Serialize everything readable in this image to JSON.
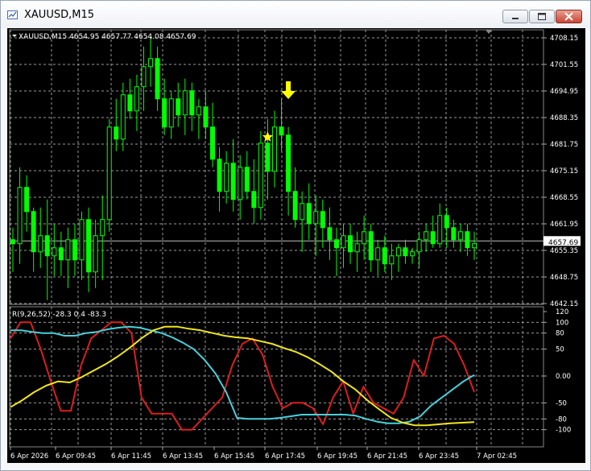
{
  "window": {
    "title": "XAUUSD,M15",
    "icon": "chart-window-icon"
  },
  "buttons": {
    "minimize_icon": "minimize-icon",
    "maximize_icon": "maximize-icon",
    "close_icon": "close-icon"
  },
  "colors": {
    "background": "#000000",
    "candle": "#00ff00",
    "price_line": "#c0c0c0",
    "red_line": "#dc1e1e",
    "cyan_line": "#46d2dc",
    "yellow_line": "#f0e61e",
    "marker": "#ffff00"
  },
  "main": {
    "info": "XAUUSD,M15  4654.95 4657.77 4654.08 4657.69",
    "current_price": "4657.69",
    "markers": [
      {
        "name": "down-arrow-icon"
      },
      {
        "name": "star-icon"
      }
    ]
  },
  "indicator": {
    "info": "R(9,26,52) -28.3 0.4 -83.3"
  },
  "x_labels": [
    "6 Apr 2026",
    "6 Apr 09:45",
    "6 Apr 11:45",
    "6 Apr 13:45",
    "6 Apr 15:45",
    "6 Apr 17:45",
    "6 Apr 19:45",
    "6 Apr 21:45",
    "6 Apr 23:45",
    "7 Apr 02:45"
  ],
  "chart_data": [
    {
      "type": "candlestick",
      "title": "XAUUSD,M15",
      "ylim": [
        4642.15,
        4708.15
      ],
      "y_ticks": [
        "4708.15",
        "4701.55",
        "4694.95",
        "4688.35",
        "4681.75",
        "4675.15",
        "4668.55",
        "4661.95",
        "4655.35",
        "4648.75",
        "4642.15"
      ],
      "last_price": 4657.69,
      "candles": [
        [
          4658,
          4661,
          4650,
          4657
        ],
        [
          4657,
          4676,
          4652,
          4671
        ],
        [
          4671,
          4674,
          4660,
          4665
        ],
        [
          4665,
          4666,
          4650,
          4655
        ],
        [
          4655,
          4666,
          4651,
          4659
        ],
        [
          4659,
          4668,
          4643,
          4654
        ],
        [
          4654,
          4662,
          4649,
          4656
        ],
        [
          4656,
          4660,
          4649,
          4653
        ],
        [
          4653,
          4661,
          4646,
          4658
        ],
        [
          4658,
          4662,
          4649,
          4653
        ],
        [
          4653,
          4665,
          4648,
          4663
        ],
        [
          4663,
          4666,
          4645,
          4650
        ],
        [
          4650,
          4663,
          4646,
          4659
        ],
        [
          4659,
          4669,
          4648,
          4663
        ],
        [
          4663,
          4688,
          4660,
          4686
        ],
        [
          4686,
          4693,
          4680,
          4683
        ],
        [
          4683,
          4697,
          4680,
          4694
        ],
        [
          4694,
          4698,
          4688,
          4690
        ],
        [
          4690,
          4699,
          4685,
          4696
        ],
        [
          4696,
          4706,
          4690,
          4701
        ],
        [
          4701,
          4708,
          4696,
          4703
        ],
        [
          4703,
          4706,
          4690,
          4693
        ],
        [
          4693,
          4698,
          4684,
          4686
        ],
        [
          4686,
          4695,
          4683,
          4693
        ],
        [
          4693,
          4697,
          4686,
          4689
        ],
        [
          4689,
          4698,
          4684,
          4695
        ],
        [
          4695,
          4697,
          4685,
          4689
        ],
        [
          4689,
          4693,
          4683,
          4691
        ],
        [
          4691,
          4695,
          4683,
          4686
        ],
        [
          4686,
          4692,
          4676,
          4678
        ],
        [
          4678,
          4681,
          4665,
          4670
        ],
        [
          4670,
          4680,
          4667,
          4677
        ],
        [
          4677,
          4683,
          4665,
          4668
        ],
        [
          4668,
          4679,
          4663,
          4676
        ],
        [
          4676,
          4680,
          4668,
          4670
        ],
        [
          4670,
          4678,
          4662,
          4666
        ],
        [
          4666,
          4685,
          4663,
          4682
        ],
        [
          4682,
          4688,
          4668,
          4675
        ],
        [
          4675,
          4690,
          4671,
          4686
        ],
        [
          4686,
          4693,
          4680,
          4684
        ],
        [
          4684,
          4686,
          4664,
          4670
        ],
        [
          4670,
          4676,
          4661,
          4663
        ],
        [
          4663,
          4670,
          4655,
          4667
        ],
        [
          4667,
          4672,
          4658,
          4662
        ],
        [
          4662,
          4669,
          4654,
          4665
        ],
        [
          4665,
          4668,
          4656,
          4661
        ],
        [
          4661,
          4666,
          4653,
          4658
        ],
        [
          4658,
          4661,
          4649,
          4656
        ],
        [
          4656,
          4662,
          4651,
          4659
        ],
        [
          4659,
          4662,
          4652,
          4655
        ],
        [
          4655,
          4660,
          4650,
          4657
        ],
        [
          4657,
          4664,
          4653,
          4660
        ],
        [
          4660,
          4662,
          4650,
          4653
        ],
        [
          4653,
          4658,
          4649,
          4656
        ],
        [
          4656,
          4659,
          4650,
          4652
        ],
        [
          4652,
          4657,
          4648,
          4654
        ],
        [
          4654,
          4657,
          4650,
          4656
        ],
        [
          4656,
          4658,
          4652,
          4654
        ],
        [
          4654,
          4656,
          4652,
          4655
        ],
        [
          4655,
          4660,
          4651,
          4658
        ],
        [
          4658,
          4662,
          4655,
          4660
        ],
        [
          4660,
          4664,
          4656,
          4657
        ],
        [
          4657,
          4667,
          4656,
          4664
        ],
        [
          4664,
          4666,
          4656,
          4661
        ],
        [
          4661,
          4663,
          4656,
          4658
        ],
        [
          4658,
          4662,
          4655,
          4660
        ],
        [
          4660,
          4662,
          4654,
          4656
        ],
        [
          4656,
          4660,
          4653,
          4657
        ]
      ]
    },
    {
      "type": "line",
      "title": "R(9,26,52)",
      "ylim": [
        -120,
        120
      ],
      "y_ticks": [
        120,
        100,
        80,
        50,
        0.0,
        -50,
        -80,
        -100
      ],
      "series": [
        {
          "values": [
            70,
            100,
            100,
            50,
            -10,
            -65,
            -65,
            20,
            70,
            85,
            100,
            100,
            80,
            -40,
            -70,
            -70,
            -70,
            -100,
            -100,
            -80,
            -60,
            -40,
            20,
            60,
            70,
            40,
            -20,
            -60,
            -50,
            -50,
            -60,
            -90,
            -40,
            -10,
            -70,
            -20,
            -50,
            -60,
            -70,
            -40,
            30,
            0,
            70,
            75,
            60,
            20,
            -30
          ]
        },
        {
          "values": [
            85,
            85,
            82,
            80,
            80,
            75,
            75,
            80,
            82,
            87,
            90,
            92,
            90,
            85,
            80,
            72,
            62,
            50,
            30,
            5,
            -30,
            -78,
            -80,
            -80,
            -80,
            -78,
            -75,
            -72,
            -72,
            -72,
            -72,
            -72,
            -74,
            -80,
            -85,
            -88,
            -88,
            -85,
            -75,
            -55,
            -40,
            -25,
            -10,
            2
          ]
        },
        {
          "values": [
            -58,
            -45,
            -30,
            -18,
            -10,
            -12,
            -2,
            10,
            22,
            36,
            52,
            70,
            85,
            92,
            92,
            88,
            85,
            80,
            75,
            72,
            70,
            65,
            60,
            52,
            45,
            35,
            22,
            8,
            -10,
            -25,
            -45,
            -62,
            -78,
            -87,
            -92,
            -92,
            -90,
            -88,
            -87,
            -86
          ]
        }
      ]
    }
  ]
}
